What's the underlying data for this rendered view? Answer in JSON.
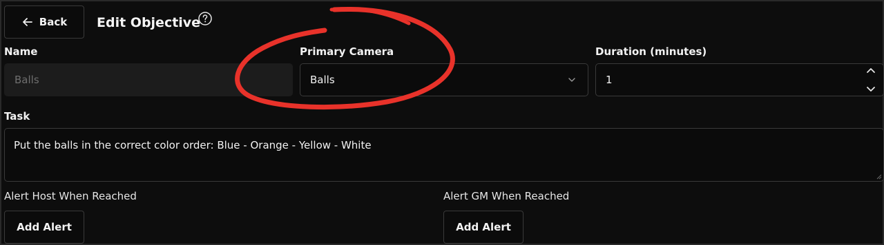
{
  "header": {
    "back_label": "Back",
    "title": "Edit Objective",
    "help_icon": "question-circle-icon"
  },
  "form": {
    "name": {
      "label": "Name",
      "value": "Balls",
      "disabled": true
    },
    "primary_camera": {
      "label": "Primary Camera",
      "selected": "Balls"
    },
    "duration": {
      "label": "Duration (minutes)",
      "value": "1"
    },
    "task": {
      "label": "Task",
      "value": "Put the balls in the correct color order: Blue - Orange - Yellow - White"
    },
    "alert_host": {
      "label": "Alert Host When Reached",
      "button_label": "Add Alert"
    },
    "alert_gm": {
      "label": "Alert GM When Reached",
      "button_label": "Add Alert"
    }
  },
  "colors": {
    "background": "#0d0d0d",
    "border": "#3a3a3a",
    "annotation": "#e8322a"
  }
}
